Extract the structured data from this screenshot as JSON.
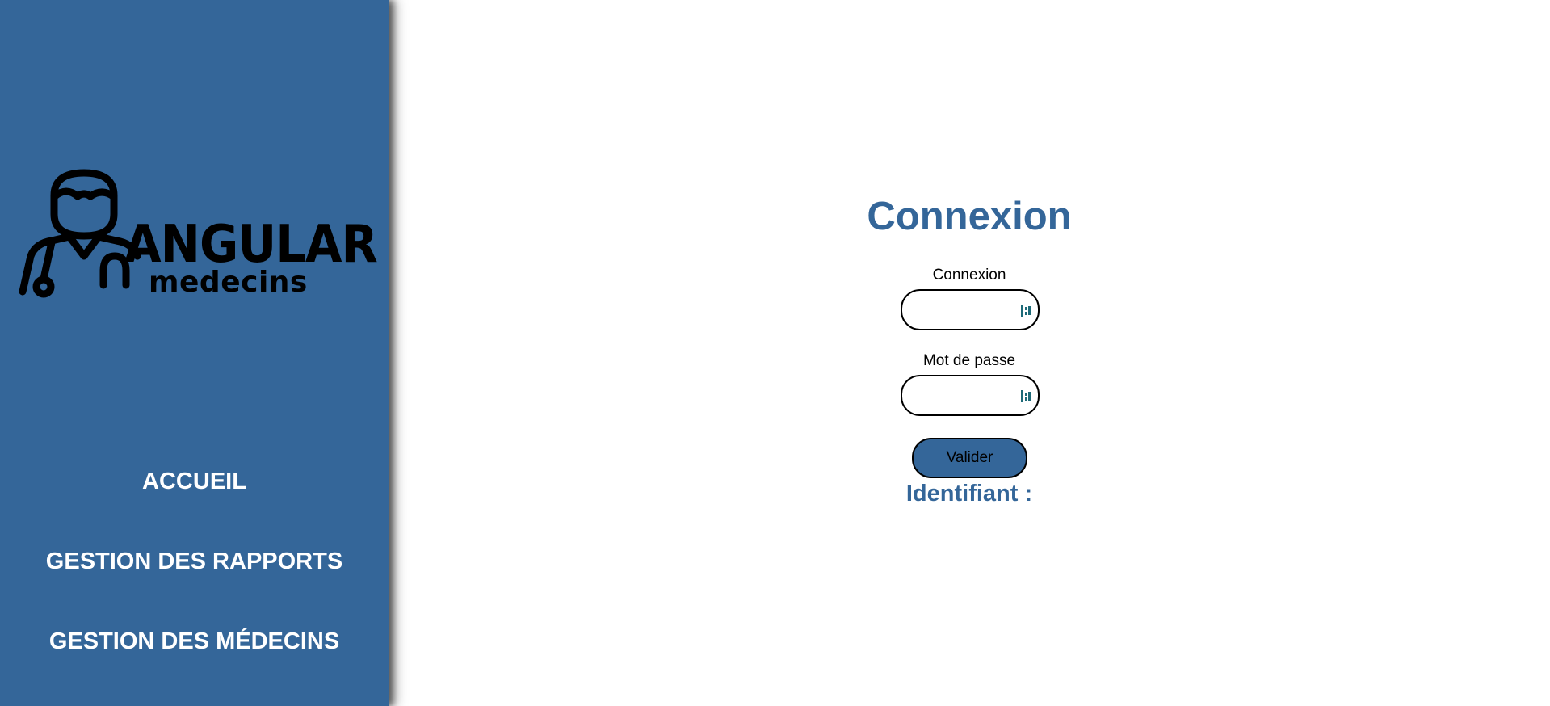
{
  "sidebar": {
    "logo": {
      "word": "ANGULAR",
      "sub": "medecins"
    },
    "nav": [
      {
        "label": "ACCUEIL"
      },
      {
        "label": "GESTION DES RAPPORTS"
      },
      {
        "label": "GESTION DES MÉDECINS"
      }
    ]
  },
  "main": {
    "title": "Connexion",
    "login_label": "Connexion",
    "login_value": "",
    "password_label": "Mot de passe",
    "password_value": "",
    "submit_label": "Valider",
    "identifier_text": "Identifiant :"
  },
  "icons": {
    "field_icon": "password-manager-key-icon"
  },
  "colors": {
    "sidebar_bg": "#346699",
    "accent": "#346699",
    "field_icon": "#1d6a78"
  }
}
